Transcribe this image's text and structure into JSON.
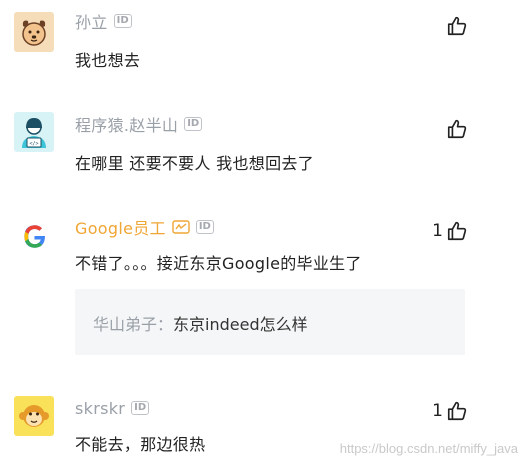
{
  "comments": [
    {
      "author": "孙立",
      "tag": "ID",
      "text": "我也想去",
      "avatar_icon": "dog-avatar-icon"
    },
    {
      "author": "程序猿.赵半山",
      "tag": "ID",
      "text": "在哪里 还要不要人 我也想回去了",
      "avatar_icon": "programmer-avatar-icon"
    },
    {
      "author": "Google员工",
      "tag": "ID",
      "text": "不错了。。。接近东京Google的毕业生了",
      "likes": "1",
      "avatar_icon": "google-logo-icon",
      "reply": {
        "author": "华山弟子",
        "separator": "：",
        "text": "东京indeed怎么样"
      }
    },
    {
      "author": "skrskr",
      "tag": "ID",
      "text": "不能去，那边很热",
      "likes": "1",
      "avatar_icon": "monkey-avatar-icon"
    }
  ],
  "watermark": "https://blog.csdn.net/miffy_java",
  "colors": {
    "name_gray": "#9aa0a8",
    "official_orange": "#f0a634",
    "google_blue": "#4285F4",
    "google_red": "#EA4335",
    "google_yellow": "#FBBC05",
    "google_green": "#34A853"
  }
}
